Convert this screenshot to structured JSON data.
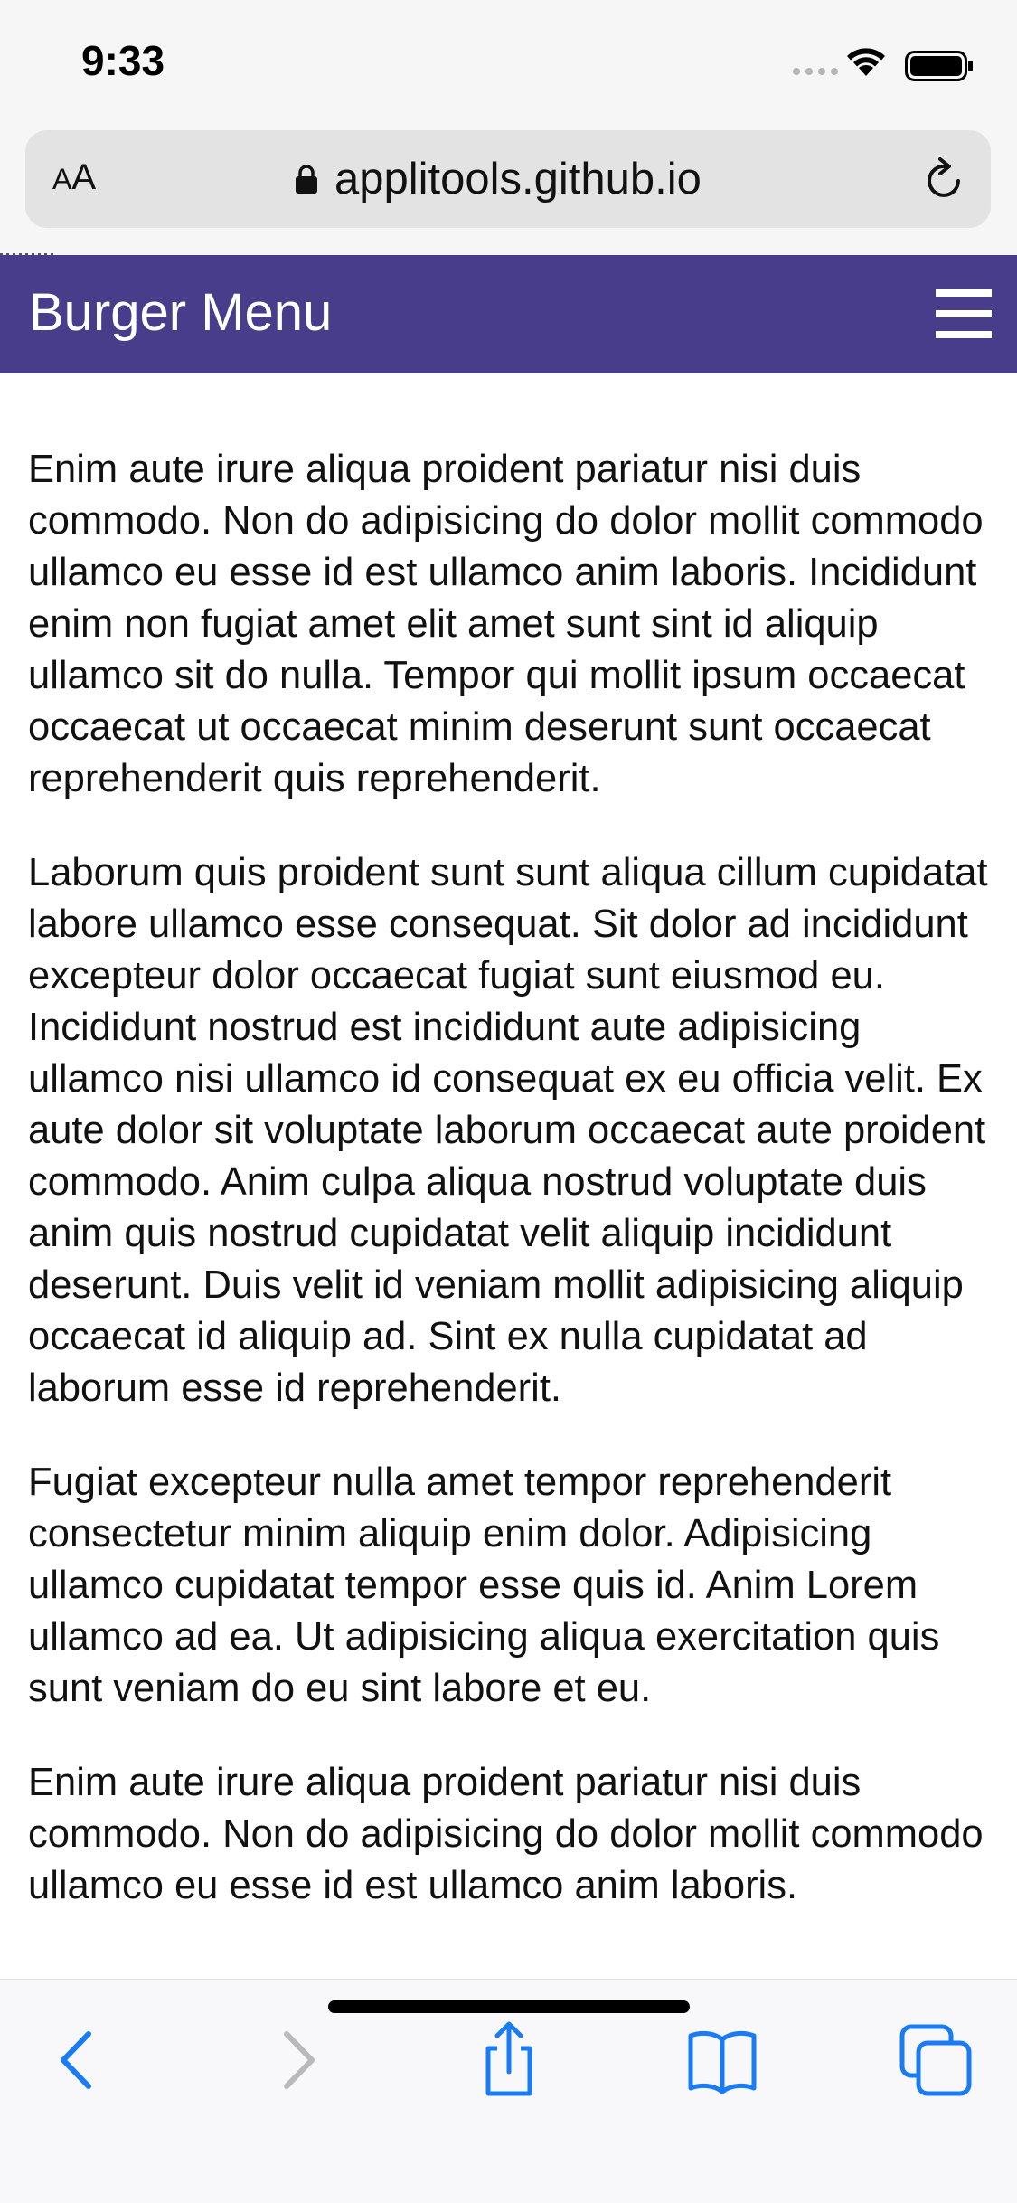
{
  "status_bar": {
    "time": "9:33"
  },
  "browser": {
    "text_size_label_small": "A",
    "text_size_label_large": "A",
    "url": "applitools.github.io"
  },
  "header": {
    "title": "Burger Menu",
    "background_color": "#483d8b",
    "menu_icon": "hamburger-icon"
  },
  "content": {
    "paragraphs": [
      "Enim aute irure aliqua proident pariatur nisi duis commodo. Non do adipisicing do dolor mollit commodo ullamco eu esse id est ullamco anim laboris. Incididunt enim non fugiat amet elit amet sunt sint id aliquip ullamco sit do nulla. Tempor qui mollit ipsum occaecat occaecat ut occaecat minim deserunt sunt occaecat reprehenderit quis reprehenderit.",
      "Laborum quis proident sunt sunt aliqua cillum cupidatat labore ullamco esse consequat. Sit dolor ad incididunt excepteur dolor occaecat fugiat sunt eiusmod eu. Incididunt nostrud est incididunt aute adipisicing ullamco nisi ullamco id consequat ex eu officia velit. Ex aute dolor sit voluptate laborum occaecat aute proident commodo. Anim culpa aliqua nostrud voluptate duis anim quis nostrud cupidatat velit aliquip incididunt deserunt. Duis velit id veniam mollit adipisicing aliquip occaecat id aliquip ad. Sint ex nulla cupidatat ad laborum esse id reprehenderit.",
      "Fugiat excepteur nulla amet tempor reprehenderit consectetur minim aliquip enim dolor. Adipisicing ullamco cupidatat tempor esse quis id. Anim Lorem ullamco ad ea. Ut adipisicing aliqua exercitation quis sunt veniam do eu sint labore et eu.",
      "Enim aute irure aliqua proident pariatur nisi duis commodo. Non do adipisicing do dolor mollit commodo ullamco eu esse id est ullamco anim laboris."
    ]
  },
  "toolbar": {
    "accent_color": "#1a7cf5",
    "disabled_color": "#b8b8bd",
    "icons": [
      "back-icon",
      "forward-icon",
      "share-icon",
      "bookmarks-icon",
      "tabs-icon"
    ]
  }
}
